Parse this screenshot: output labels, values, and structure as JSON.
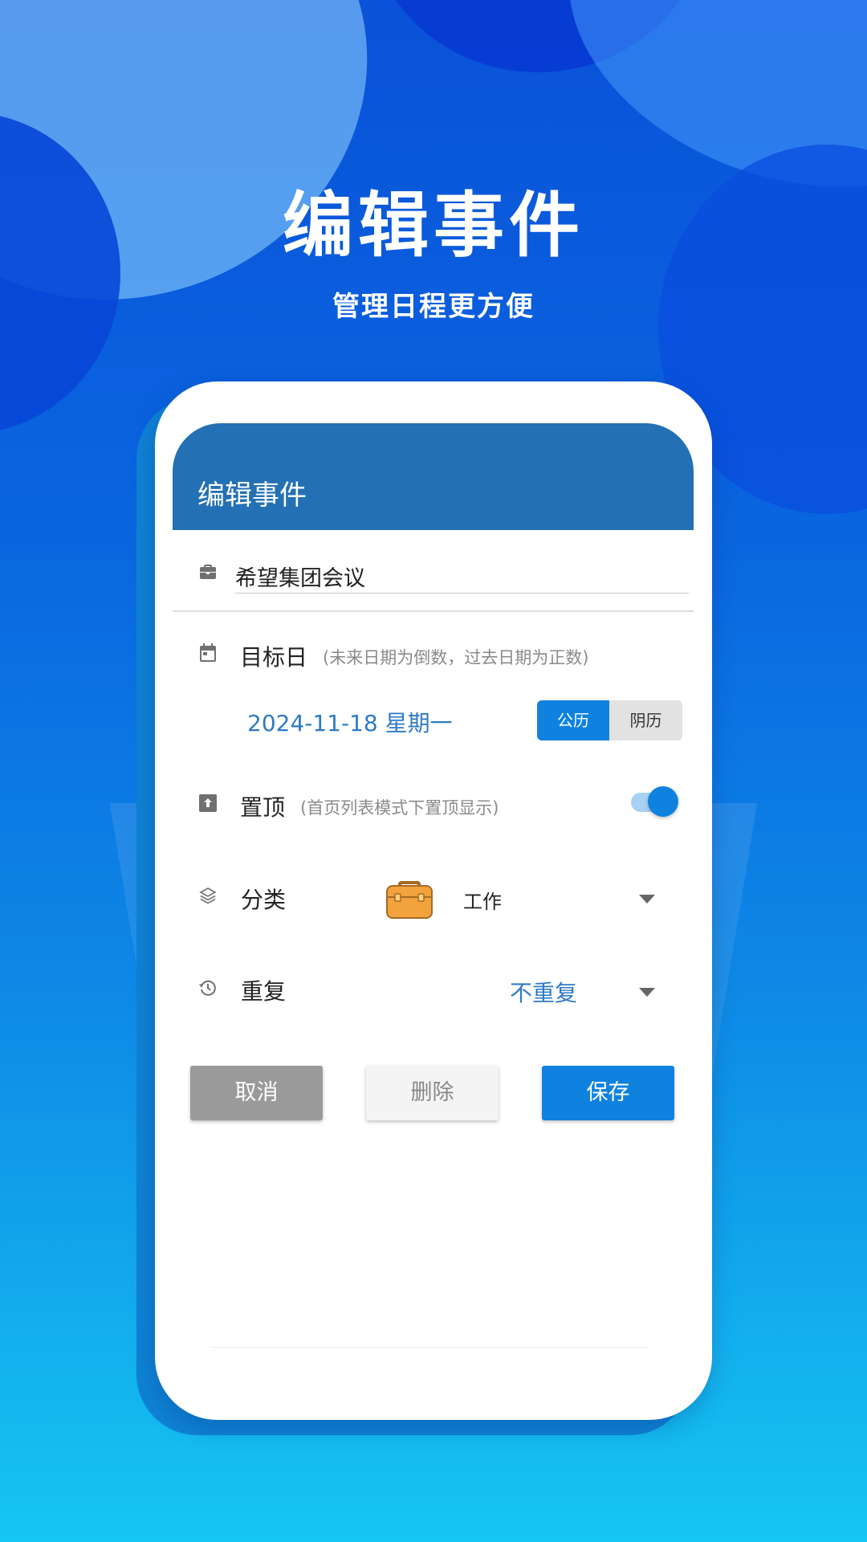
{
  "promo": {
    "headline": "编辑事件",
    "subline": "管理日程更方便"
  },
  "app": {
    "header_title": "编辑事件",
    "event_title_value": "希望集团会议",
    "target_date": {
      "label": "目标日",
      "hint": "(未来日期为倒数，过去日期为正数)",
      "value": "2024-11-18 星期一",
      "calendar_options": [
        "公历",
        "阴历"
      ],
      "selected_calendar": "公历"
    },
    "pin": {
      "label": "置顶",
      "hint": "(首页列表模式下置顶显示)",
      "enabled": true
    },
    "category": {
      "label": "分类",
      "value": "工作",
      "icon": "briefcase-icon"
    },
    "repeat": {
      "label": "重复",
      "value": "不重复"
    },
    "buttons": {
      "cancel": "取消",
      "delete": "删除",
      "save": "保存"
    }
  },
  "colors": {
    "header": "#2470b5",
    "accent": "#0f82df",
    "link_text": "#2e7bc6",
    "cancel_button": "#9a9a9a",
    "background_top": "#0a52d8",
    "background_bottom": "#16c6f2"
  }
}
